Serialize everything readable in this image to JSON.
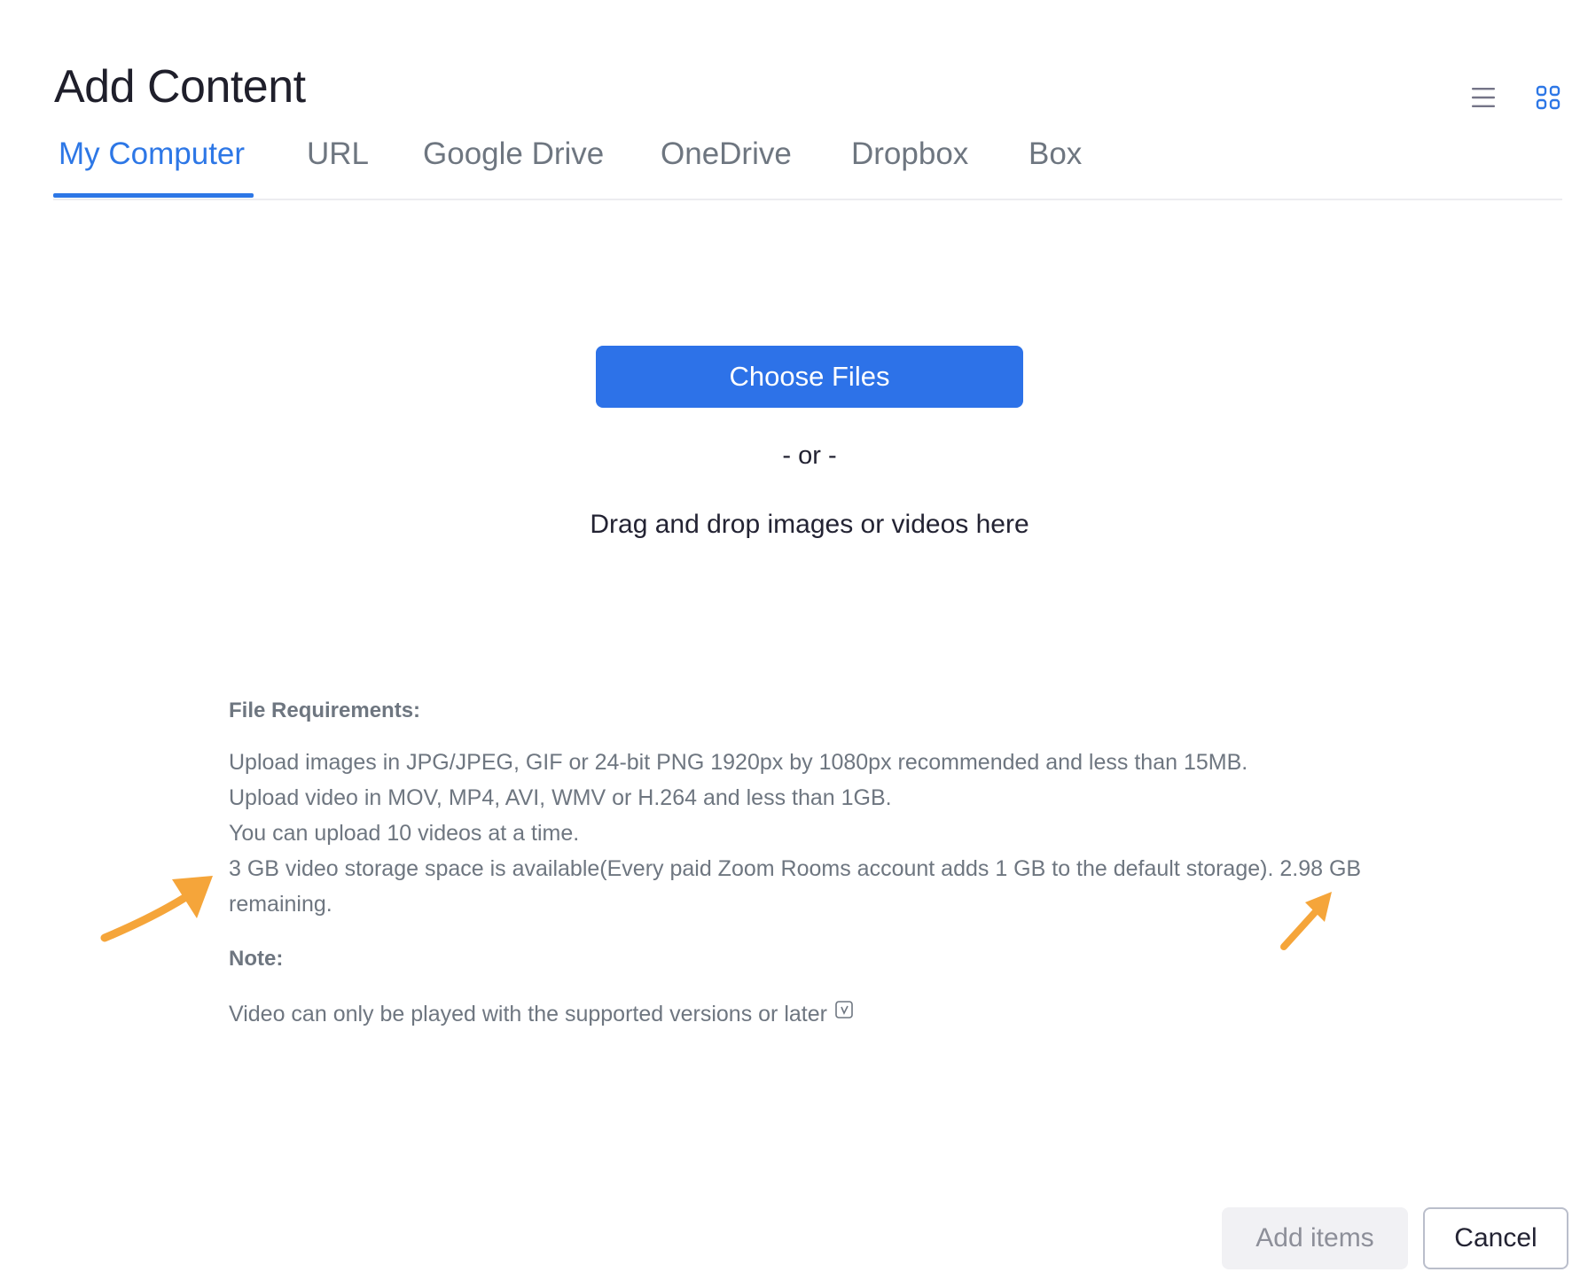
{
  "dialog": {
    "title": "Add Content"
  },
  "view_toggle": {
    "list_icon": "list-view-icon",
    "grid_icon": "grid-view-icon"
  },
  "tabs": [
    {
      "label": "My Computer",
      "active": true
    },
    {
      "label": "URL",
      "active": false
    },
    {
      "label": "Google Drive",
      "active": false
    },
    {
      "label": "OneDrive",
      "active": false
    },
    {
      "label": "Dropbox",
      "active": false
    },
    {
      "label": "Box",
      "active": false
    }
  ],
  "upload": {
    "choose_label": "Choose Files",
    "or_text": "- or -",
    "drop_text": "Drag and drop images or videos here"
  },
  "requirements": {
    "heading": "File Requirements:",
    "lines": [
      "Upload images in JPG/JPEG, GIF or 24-bit PNG 1920px by 1080px recommended and less than 15MB.",
      "Upload video in MOV, MP4, AVI, WMV or H.264 and less than 1GB.",
      "You can upload 10 videos at a time.",
      "3 GB video storage space is available(Every paid Zoom Rooms account adds 1 GB to the default storage). 2.98 GB remaining."
    ],
    "note_heading": "Note:",
    "note_text": "Video can only be played with the supported versions or later"
  },
  "footer": {
    "add_label": "Add items",
    "cancel_label": "Cancel"
  },
  "colors": {
    "accent": "#2d77e6",
    "annotation_arrow": "#f5a53a"
  }
}
